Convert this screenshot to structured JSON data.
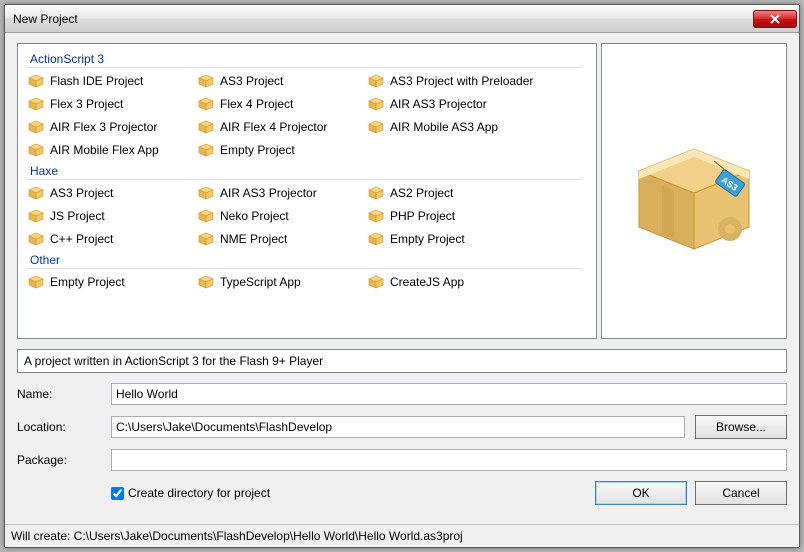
{
  "window": {
    "title": "New Project"
  },
  "categories": [
    {
      "label": "ActionScript 3",
      "templates": [
        "Flash IDE Project",
        "AS3 Project",
        "AS3 Project with Preloader",
        "Flex 3 Project",
        "Flex 4 Project",
        "AIR AS3 Projector",
        "AIR Flex 3 Projector",
        "AIR Flex 4 Projector",
        "AIR Mobile AS3 App",
        "AIR Mobile Flex App",
        "Empty Project"
      ]
    },
    {
      "label": "Haxe",
      "templates": [
        "AS3 Project",
        "AIR AS3 Projector",
        "AS2 Project",
        "JS Project",
        "Neko Project",
        "PHP Project",
        "C++ Project",
        "NME Project",
        "Empty Project"
      ]
    },
    {
      "label": "Other",
      "templates": [
        "Empty Project",
        "TypeScript App",
        "CreateJS App"
      ]
    }
  ],
  "description": "A project written in ActionScript 3 for the Flash 9+ Player",
  "form": {
    "name_label": "Name:",
    "name_value": "Hello World",
    "location_label": "Location:",
    "location_value": "C:\\Users\\Jake\\Documents\\FlashDevelop",
    "package_label": "Package:",
    "package_value": "",
    "browse_label": "Browse...",
    "create_dir_label": "Create directory for project",
    "create_dir_checked": true
  },
  "buttons": {
    "ok": "OK",
    "cancel": "Cancel"
  },
  "status": "Will create: C:\\Users\\Jake\\Documents\\FlashDevelop\\Hello World\\Hello World.as3proj"
}
